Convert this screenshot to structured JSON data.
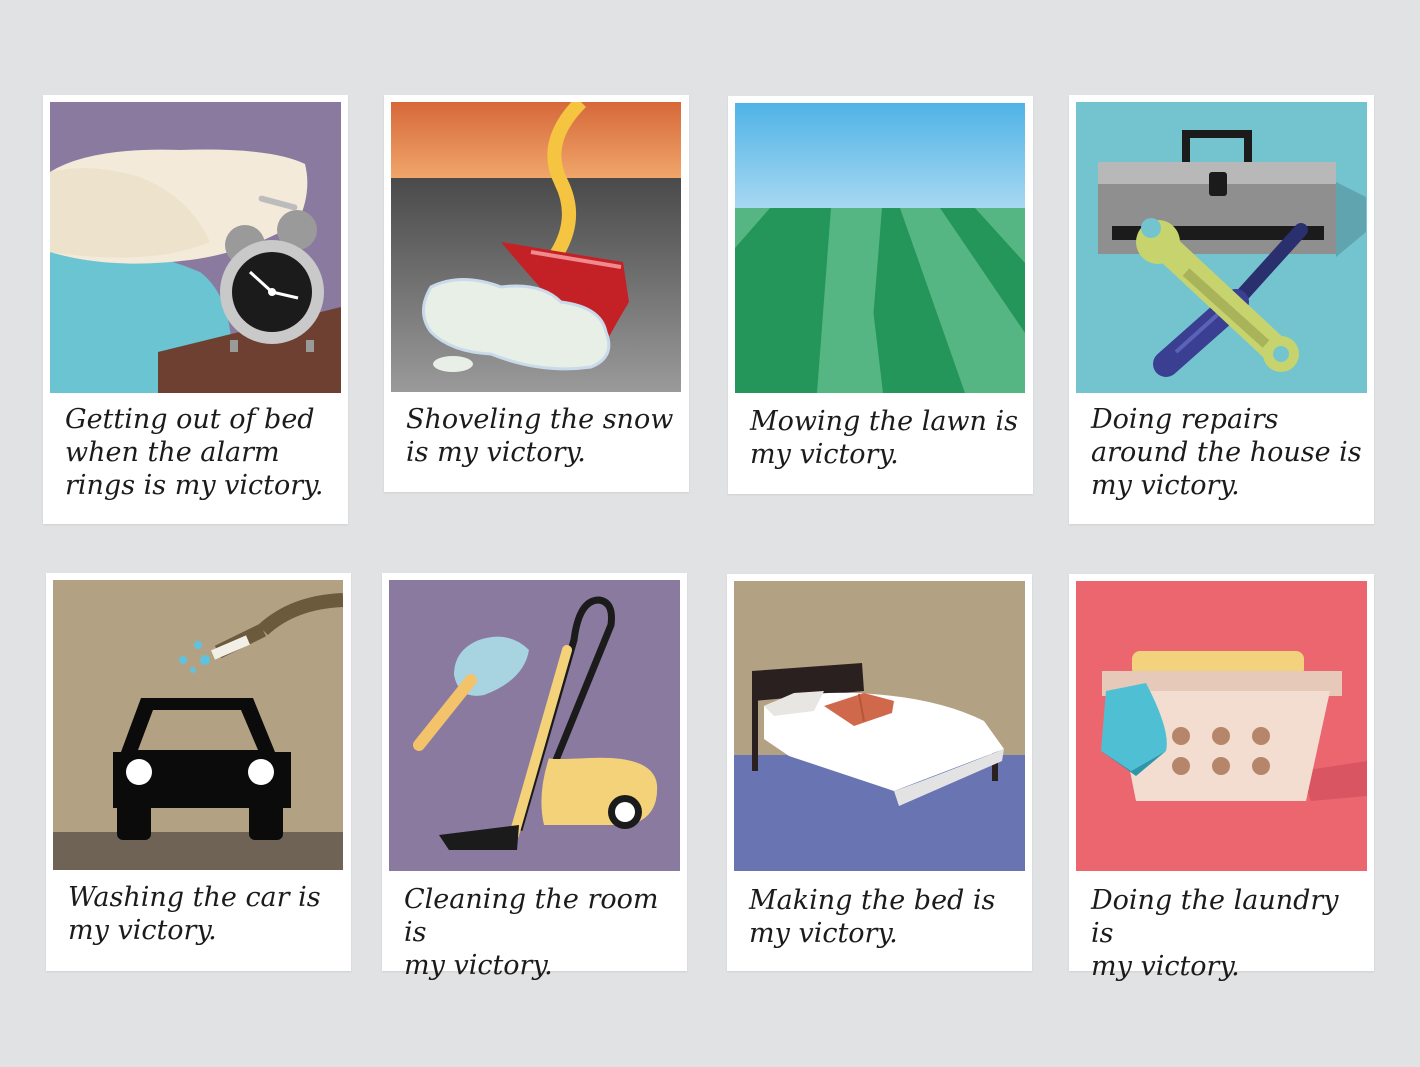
{
  "cards": [
    {
      "caption": "Getting out of bed\nwhen the alarm\nrings is my victory.",
      "icons": [
        "pillow-icon",
        "alarm-clock-icon"
      ]
    },
    {
      "caption": "Shoveling the snow\nis my victory.",
      "icons": [
        "snow-shovel-icon"
      ]
    },
    {
      "caption": "Mowing the lawn is\nmy victory.",
      "icons": [
        "lawn-stripes-icon"
      ]
    },
    {
      "caption": "Doing repairs\naround the house is\nmy victory.",
      "icons": [
        "toolbox-icon",
        "wrench-icon",
        "screwdriver-icon"
      ]
    },
    {
      "caption": "Washing the car is\nmy victory.",
      "icons": [
        "car-icon",
        "hose-icon"
      ]
    },
    {
      "caption": "Cleaning the room is\nmy victory.",
      "icons": [
        "feather-duster-icon",
        "vacuum-cleaner-icon"
      ]
    },
    {
      "caption": "Making the bed is\nmy victory.",
      "icons": [
        "bed-icon",
        "book-icon"
      ]
    },
    {
      "caption": "Doing the laundry is\nmy victory.",
      "icons": [
        "laundry-basket-icon",
        "towel-icon"
      ]
    }
  ]
}
